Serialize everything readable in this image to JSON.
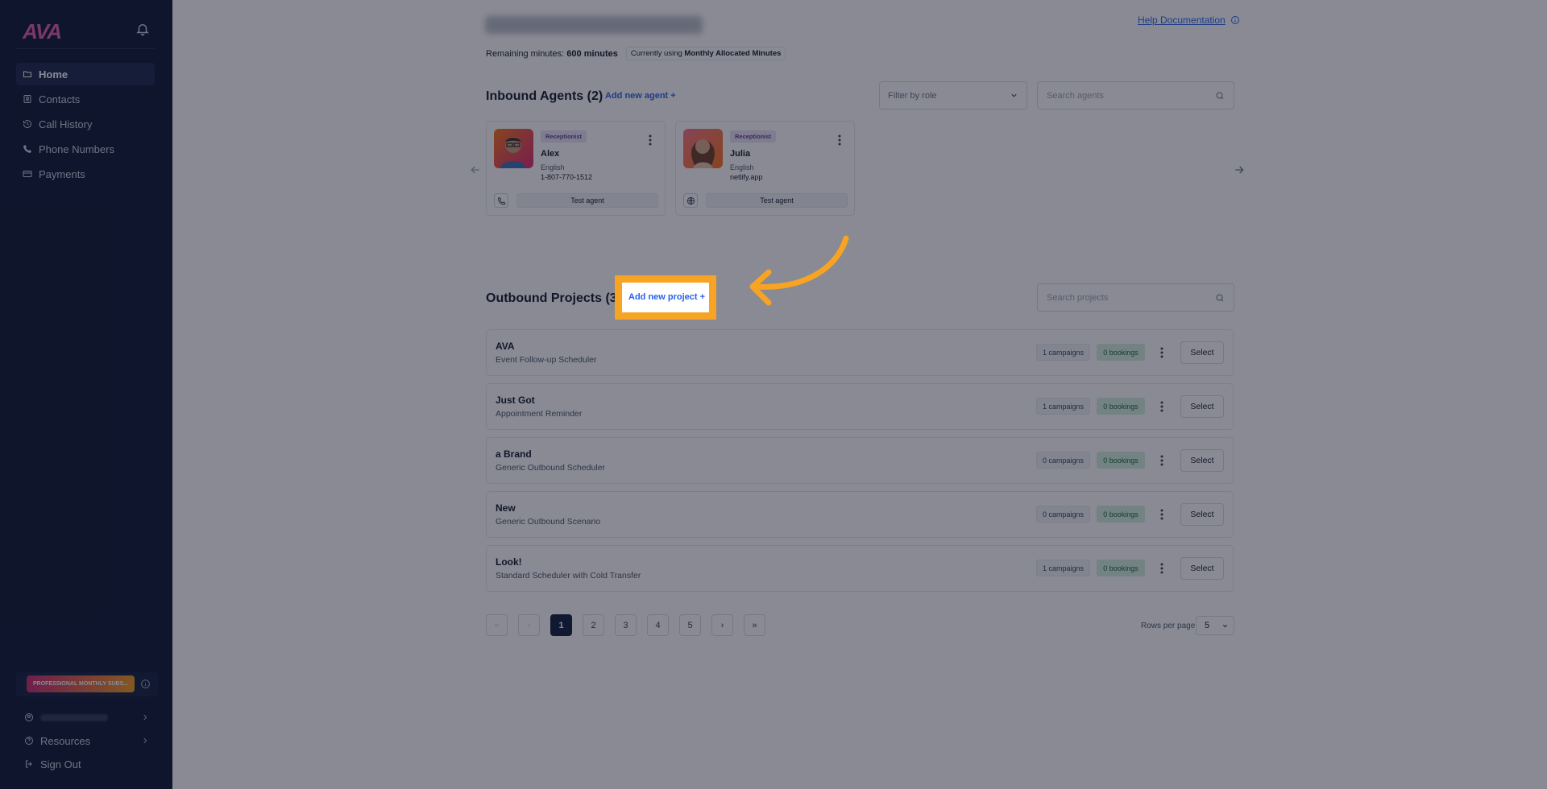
{
  "sidebar": {
    "logo": "AVA",
    "nav": [
      {
        "label": "Home",
        "icon": "folder-icon",
        "active": true
      },
      {
        "label": "Contacts",
        "icon": "contact-book-icon",
        "active": false
      },
      {
        "label": "Call History",
        "icon": "history-icon",
        "active": false
      },
      {
        "label": "Phone Numbers",
        "icon": "phone-icon",
        "active": false
      },
      {
        "label": "Payments",
        "icon": "credit-card-icon",
        "active": false
      }
    ],
    "plan_badge": "PROFESSIONAL MONTHLY SUBS...",
    "resources": "Resources",
    "sign_out": "Sign Out"
  },
  "header": {
    "help": "Help Documentation",
    "remaining_label": "Remaining minutes:",
    "remaining_value": "600 minutes",
    "using_label": "Currently using",
    "using_value": "Monthly Allocated Minutes"
  },
  "inbound": {
    "title": "Inbound Agents (2)",
    "add": "Add new agent +",
    "filter_placeholder": "Filter by role",
    "search_placeholder": "Search agents",
    "agents": [
      {
        "role": "Receptionist",
        "name": "Alex",
        "language": "English",
        "contact": "1-807-770-1512",
        "channel_icon": "phone-icon",
        "test": "Test agent"
      },
      {
        "role": "Receptionist",
        "name": "Julia",
        "language": "English",
        "contact": "netlify.app",
        "channel_icon": "globe-icon",
        "test": "Test agent"
      }
    ]
  },
  "outbound": {
    "title": "Outbound Projects (37",
    "add": "Add new project +",
    "search_placeholder": "Search projects",
    "projects": [
      {
        "name": "AVA",
        "desc": "Event Follow-up Scheduler",
        "campaigns": "1 campaigns",
        "bookings": "0 bookings",
        "select": "Select"
      },
      {
        "name": "Just Got",
        "desc": "Appointment Reminder",
        "campaigns": "1 campaigns",
        "bookings": "0 bookings",
        "select": "Select"
      },
      {
        "name": "a Brand",
        "desc": "Generic Outbound Scheduler",
        "campaigns": "0 campaigns",
        "bookings": "0 bookings",
        "select": "Select"
      },
      {
        "name": "New",
        "desc": "Generic Outbound Scenario",
        "campaigns": "0 campaigns",
        "bookings": "0 bookings",
        "select": "Select"
      },
      {
        "name": "Look!",
        "desc": "Standard Scheduler with Cold Transfer",
        "campaigns": "1 campaigns",
        "bookings": "0 bookings",
        "select": "Select"
      }
    ]
  },
  "pagination": {
    "first": "«",
    "prev": "‹",
    "pages": [
      "1",
      "2",
      "3",
      "4",
      "5"
    ],
    "next": "›",
    "last": "»",
    "current": "1",
    "rows_label": "Rows per page",
    "rows_value": "5"
  },
  "colors": {
    "sidebar_bg": "#0a1530",
    "accent": "#2563eb",
    "highlight": "#f7a324",
    "active_page": "#0f1a3a"
  }
}
